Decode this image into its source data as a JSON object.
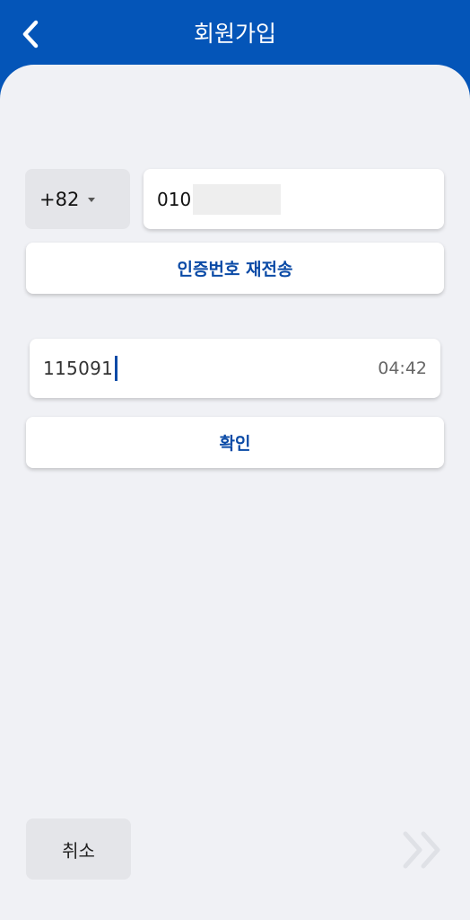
{
  "header": {
    "title": "회원가입",
    "back_icon": "chevron-left-icon"
  },
  "phone": {
    "country_code": "+82",
    "number_prefix": "010"
  },
  "resend_label": "인증번호 재전송",
  "verification": {
    "code_value": "115091",
    "timer": "04:42"
  },
  "confirm_label": "확인",
  "footer": {
    "cancel_label": "취소",
    "next_icon": "double-chevron-right-icon"
  },
  "colors": {
    "brand": "#0455b8",
    "accent_text": "#0a4aa6",
    "background": "#f0f1f5"
  }
}
